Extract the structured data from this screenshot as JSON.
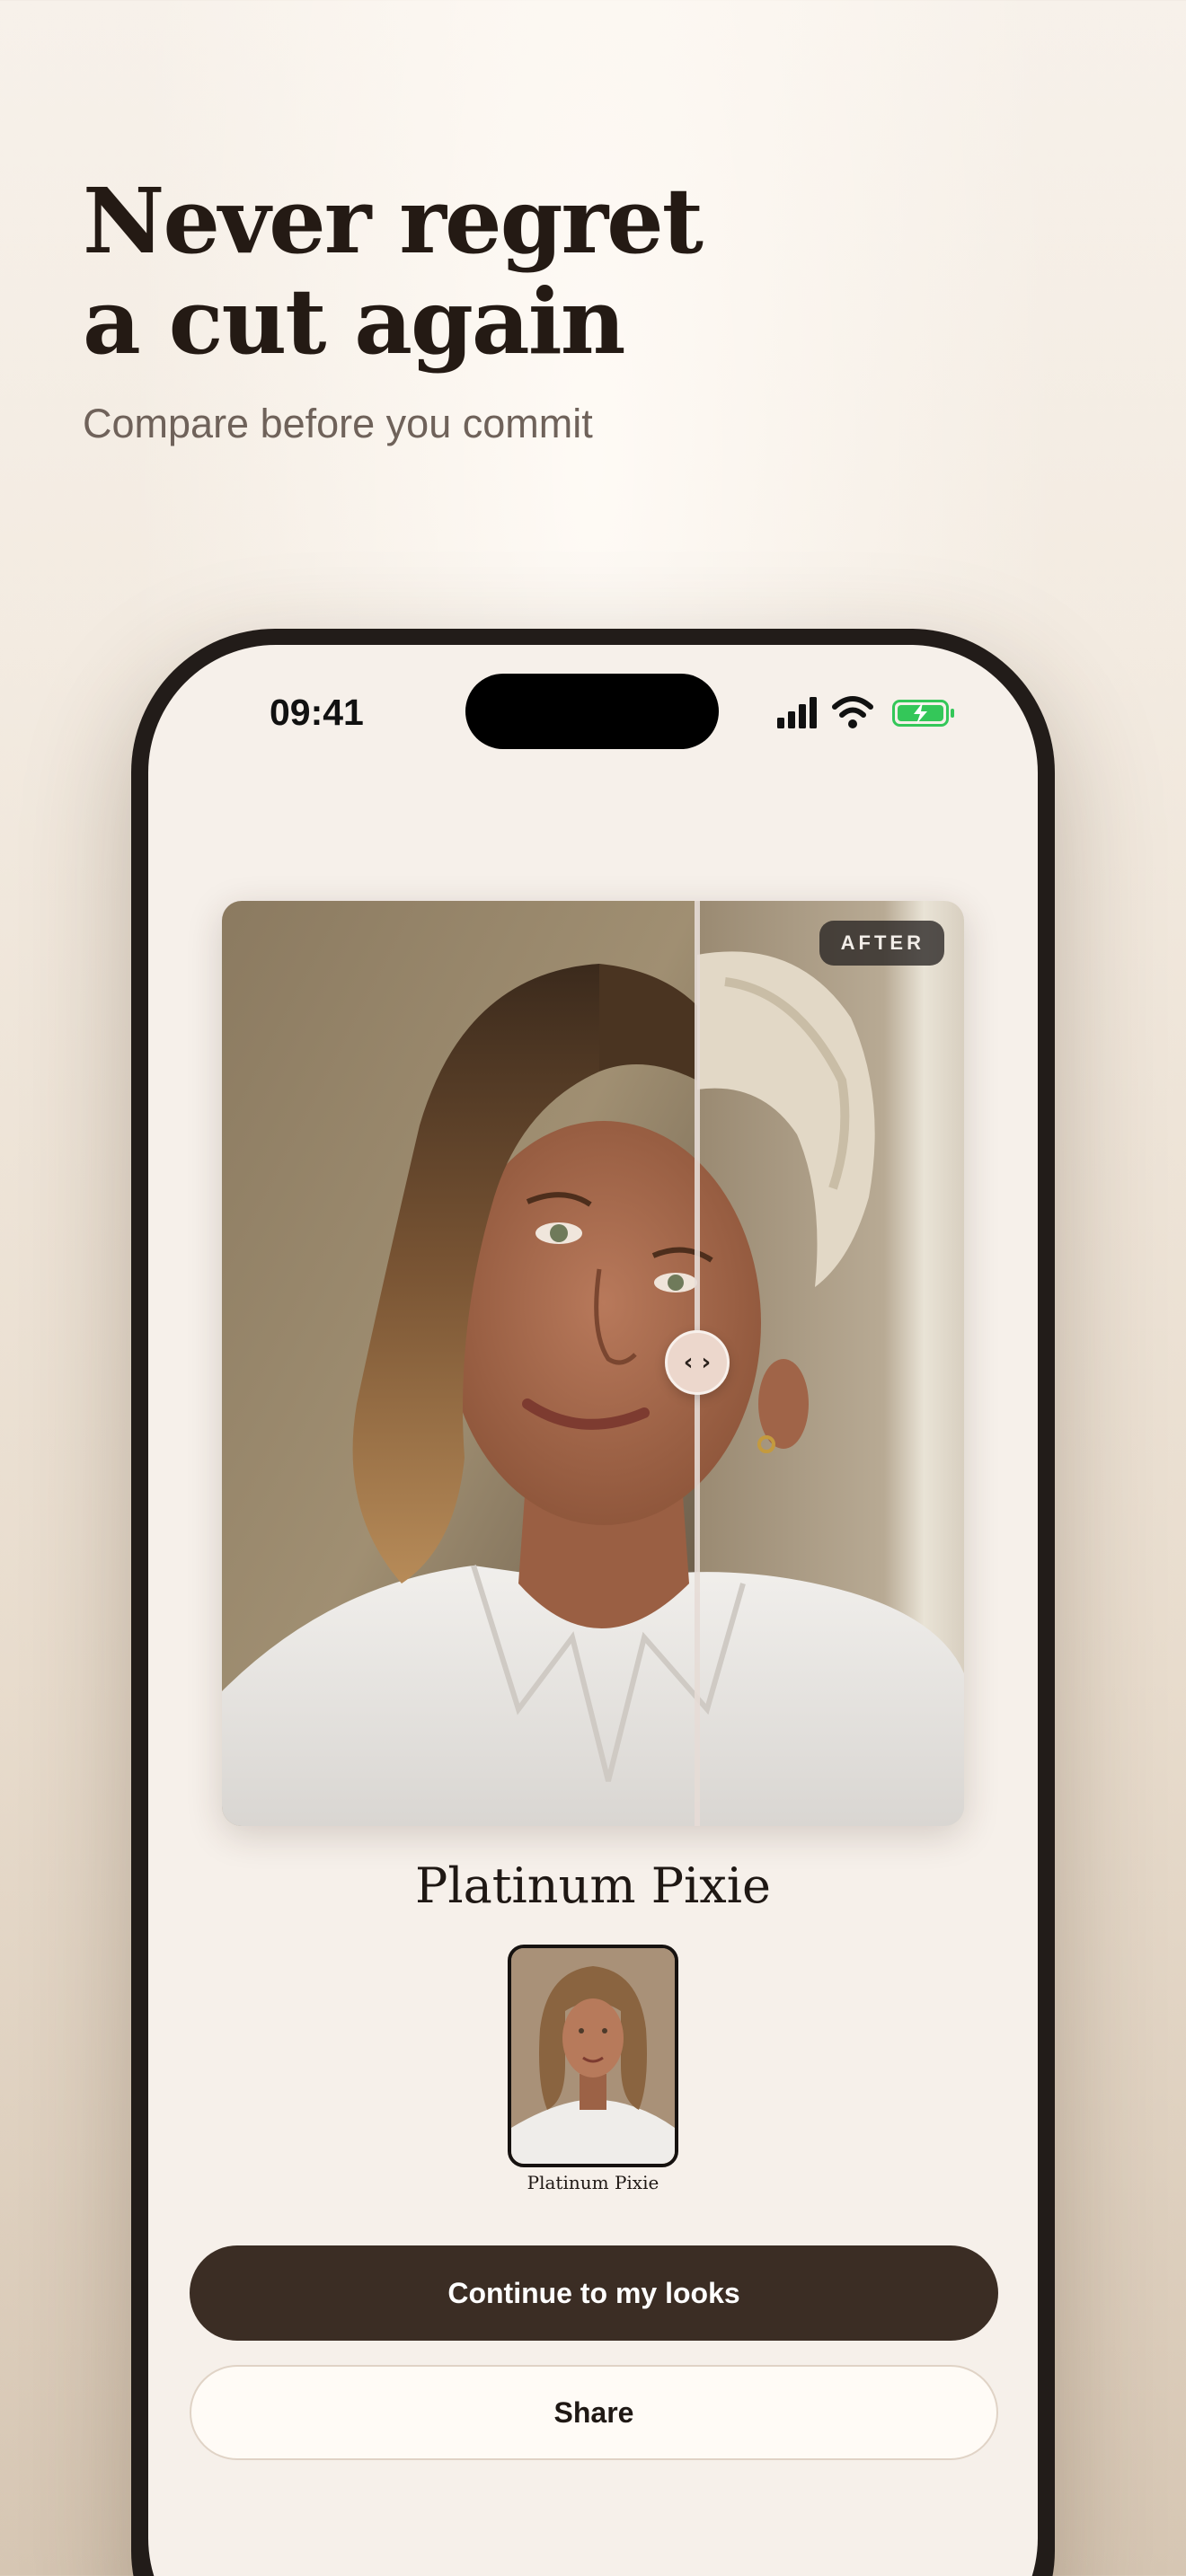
{
  "hero": {
    "headline_line1": "Never regret",
    "headline_line2": "a cut again",
    "subheadline": "Compare before you commit"
  },
  "status_bar": {
    "time": "09:41",
    "icons": [
      "cellular-signal-icon",
      "wifi-icon",
      "battery-charging-icon"
    ]
  },
  "comparison": {
    "badge": "AFTER",
    "handle_glyph": "‹ ›",
    "split_fraction": 0.64
  },
  "style": {
    "name": "Platinum Pixie",
    "thumbnail_label": "Platinum Pixie"
  },
  "actions": {
    "primary_label": "Continue to my looks",
    "secondary_label": "Share"
  },
  "colors": {
    "primary_button": "#3b2d24",
    "battery_green": "#34c759",
    "background": "#f6f0ea"
  }
}
